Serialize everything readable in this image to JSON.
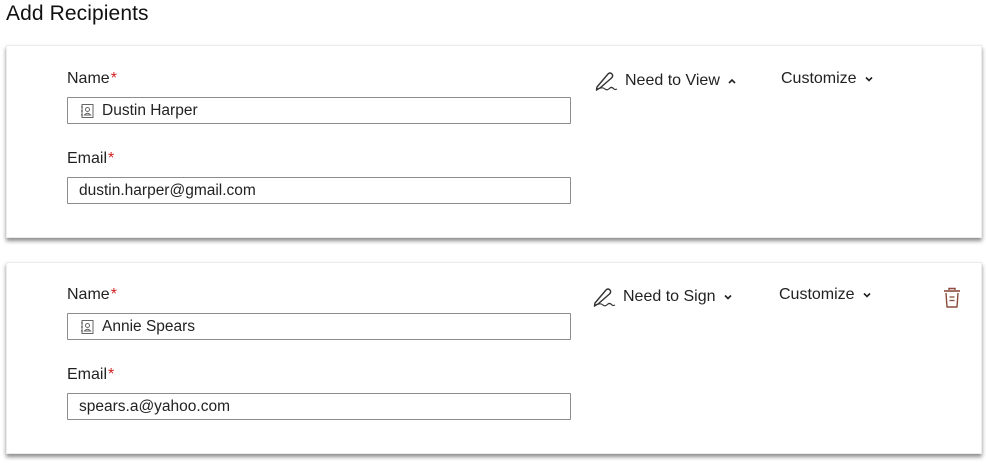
{
  "page": {
    "title": "Add Recipients"
  },
  "recipients": [
    {
      "name_label": "Name",
      "name_value": "Dustin Harper",
      "email_label": "Email",
      "email_value": "dustin.harper@gmail.com",
      "role_label": "Need to View",
      "role_chevron": "chevron-up-icon",
      "customize_label": "Customize",
      "has_delete": false
    },
    {
      "name_label": "Name",
      "name_value": "Annie Spears",
      "email_label": "Email",
      "email_value": "spears.a@yahoo.com",
      "role_label": "Need to Sign",
      "role_chevron": "chevron-down-icon",
      "customize_label": "Customize",
      "has_delete": true
    }
  ],
  "required_marker": "*",
  "colors": {
    "required": "#d32222",
    "trash_icon": "#8a4b3a",
    "field_border": "#8d8d8d"
  }
}
